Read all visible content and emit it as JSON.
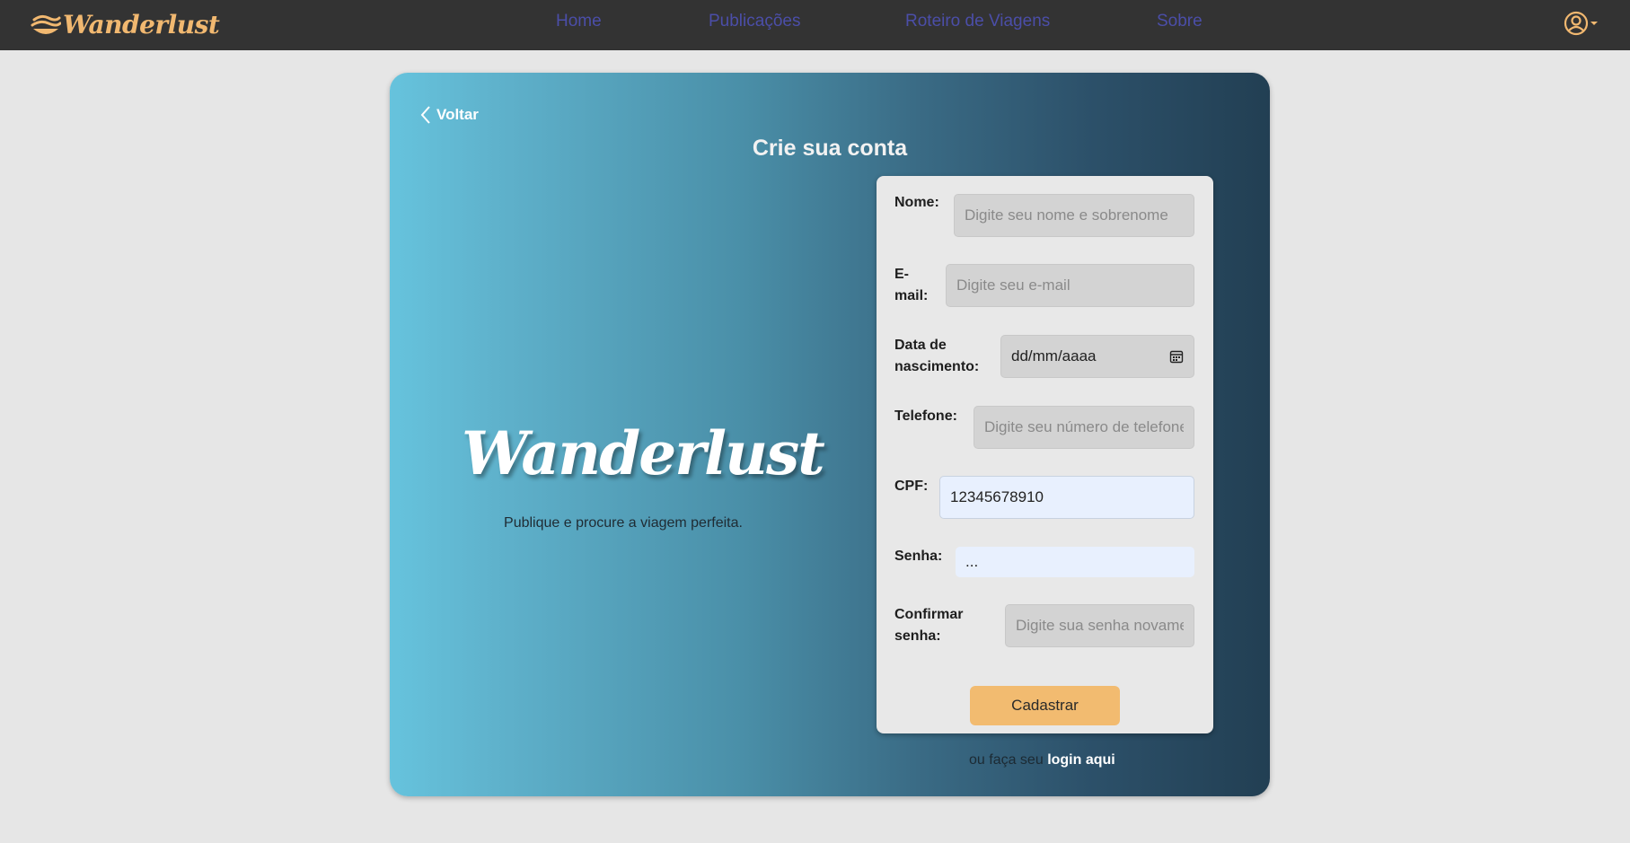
{
  "navbar": {
    "brand": "Wanderlust",
    "links": [
      "Home",
      "Publicações",
      "Roteiro de Viagens",
      "Sobre"
    ]
  },
  "card": {
    "back_label": "Voltar",
    "title": "Crie sua conta",
    "brand": "Wanderlust",
    "tagline": "Publique e procure a viagem perfeita."
  },
  "form": {
    "name": {
      "label": "Nome:",
      "placeholder": "Digite seu nome e sobrenome",
      "value": ""
    },
    "email": {
      "label_line1": "E-",
      "label_line2": "mail:",
      "placeholder": "Digite seu e-mail",
      "value": ""
    },
    "birth": {
      "label_line1": "Data de",
      "label_line2": "nascimento:",
      "value": "dd/mm/aaaa"
    },
    "phone": {
      "label": "Telefone:",
      "placeholder": "Digite seu número de telefone",
      "value": ""
    },
    "cpf": {
      "label": "CPF:",
      "value": "12345678910"
    },
    "password": {
      "label": "Senha:",
      "value": "..."
    },
    "confirm": {
      "label_line1": "Confirmar",
      "label_line2": "senha:",
      "placeholder": "Digite sua senha novamente",
      "value": ""
    },
    "submit_label": "Cadastrar"
  },
  "footer": {
    "prefix": "ou faça seu",
    "link": "login aqui"
  },
  "colors": {
    "accent": "#f2bb70",
    "nav_bg": "#333333",
    "nav_link": "#4b4ea8"
  },
  "icons": [
    "wave-logo-icon",
    "user-circle-icon",
    "caret-down-icon",
    "chevron-left-icon",
    "calendar-icon"
  ]
}
